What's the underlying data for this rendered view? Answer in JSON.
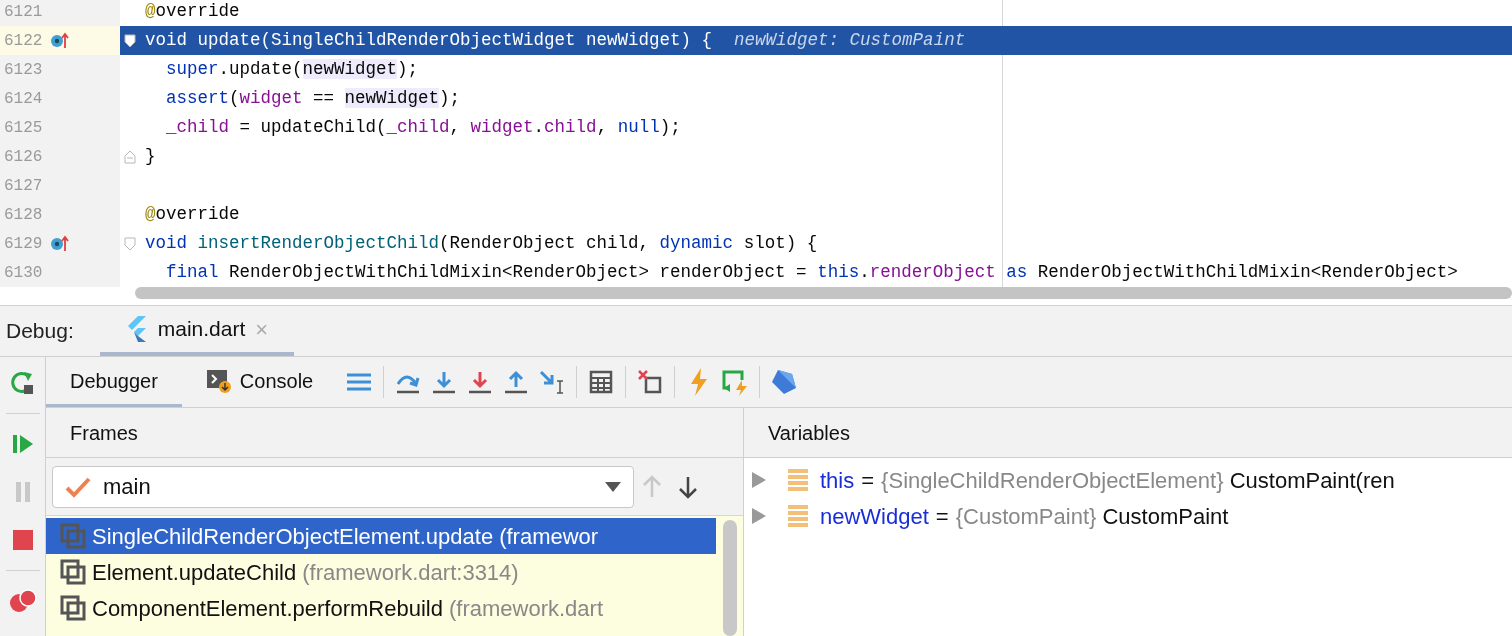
{
  "editor": {
    "lines": [
      {
        "number": "6121",
        "selected": false,
        "override_marker": false,
        "fold_start": false,
        "fold_end": false,
        "tokens": [
          {
            "t": "@",
            "kind": "at"
          },
          {
            "t": "override",
            "kind": "plain"
          }
        ]
      },
      {
        "number": "6122",
        "selected": true,
        "override_marker": true,
        "fold_start": true,
        "fold_end": false,
        "tokens": [
          {
            "t": "void update(SingleChildRenderObjectWidget newWidget) {",
            "kind": "plain"
          },
          {
            "t": "newWidget: CustomPaint",
            "kind": "hint"
          }
        ]
      },
      {
        "number": "6123",
        "selected": false,
        "override_marker": false,
        "fold_start": false,
        "fold_end": false,
        "tokens": [
          {
            "t": "  super",
            "kind": "kw"
          },
          {
            "t": ".update(",
            "kind": "plain"
          },
          {
            "t": "newWidget",
            "kind": "hl"
          },
          {
            "t": ");",
            "kind": "plain"
          }
        ]
      },
      {
        "number": "6124",
        "selected": false,
        "override_marker": false,
        "fold_start": false,
        "fold_end": false,
        "tokens": [
          {
            "t": "  assert",
            "kind": "kw"
          },
          {
            "t": "(",
            "kind": "plain"
          },
          {
            "t": "widget",
            "kind": "fld"
          },
          {
            "t": " == ",
            "kind": "plain"
          },
          {
            "t": "newWidget",
            "kind": "hl"
          },
          {
            "t": ");",
            "kind": "plain"
          }
        ]
      },
      {
        "number": "6125",
        "selected": false,
        "override_marker": false,
        "fold_start": false,
        "fold_end": false,
        "tokens": [
          {
            "t": "  _child",
            "kind": "fld"
          },
          {
            "t": " = updateChild(",
            "kind": "plain"
          },
          {
            "t": "_child",
            "kind": "fld"
          },
          {
            "t": ", ",
            "kind": "plain"
          },
          {
            "t": "widget",
            "kind": "fld"
          },
          {
            "t": ".",
            "kind": "plain"
          },
          {
            "t": "child",
            "kind": "fld"
          },
          {
            "t": ", ",
            "kind": "plain"
          },
          {
            "t": "null",
            "kind": "kw"
          },
          {
            "t": ");",
            "kind": "plain"
          }
        ]
      },
      {
        "number": "6126",
        "selected": false,
        "override_marker": false,
        "fold_start": false,
        "fold_end": true,
        "tokens": [
          {
            "t": "}",
            "kind": "plain"
          }
        ]
      },
      {
        "number": "6127",
        "selected": false,
        "override_marker": false,
        "fold_start": false,
        "fold_end": false
      },
      {
        "number": "6128",
        "selected": false,
        "override_marker": false,
        "fold_start": false,
        "fold_end": false,
        "tokens": [
          {
            "t": "@",
            "kind": "at"
          },
          {
            "t": "override",
            "kind": "plain"
          }
        ]
      },
      {
        "number": "6129",
        "selected": false,
        "override_marker": true,
        "fold_start": true,
        "fold_end": false,
        "tokens": [
          {
            "t": "void",
            "kind": "kw"
          },
          {
            "t": " insertRenderObjectChild",
            "kind": "fn"
          },
          {
            "t": "(RenderObject child, ",
            "kind": "plain"
          },
          {
            "t": "dynamic",
            "kind": "kw"
          },
          {
            "t": " slot) {",
            "kind": "plain"
          }
        ]
      },
      {
        "number": "6130",
        "selected": false,
        "override_marker": false,
        "fold_start": false,
        "fold_end": false,
        "tokens": [
          {
            "t": "  final",
            "kind": "kw"
          },
          {
            "t": " RenderObjectWithChildMixin<RenderObject> renderObject = ",
            "kind": "plain"
          },
          {
            "t": "this",
            "kind": "kw"
          },
          {
            "t": ".",
            "kind": "plain"
          },
          {
            "t": "renderObject",
            "kind": "fld"
          },
          {
            "t": " as",
            "kind": "kw"
          },
          {
            "t": " RenderObjectWithChildMixin<RenderObject>",
            "kind": "plain"
          }
        ]
      }
    ]
  },
  "debug": {
    "label": "Debug:",
    "tabs": [
      {
        "label": "main.dart",
        "selected": true,
        "close": "×"
      }
    ],
    "subtabs": [
      {
        "label": "Debugger",
        "selected": true,
        "kind": "plain"
      },
      {
        "label": "Console",
        "selected": false,
        "kind": "console"
      }
    ],
    "frames": {
      "title": "Frames",
      "thread": "main",
      "items": [
        {
          "method": "SingleChildRenderObjectElement.update",
          "location": "(framewor",
          "selected": true
        },
        {
          "method": "Element.updateChild",
          "location": "(framework.dart:3314)",
          "selected": false
        },
        {
          "method": "ComponentElement.performRebuild",
          "location": "(framework.dart",
          "selected": false
        }
      ]
    },
    "variables": {
      "title": "Variables",
      "items": [
        {
          "name": "this",
          "operator": "=",
          "type": "{SingleChildRenderObjectElement}",
          "value": "CustomPaint(ren"
        },
        {
          "name": "newWidget",
          "operator": "=",
          "type": "{CustomPaint}",
          "value": "CustomPaint"
        }
      ]
    }
  }
}
